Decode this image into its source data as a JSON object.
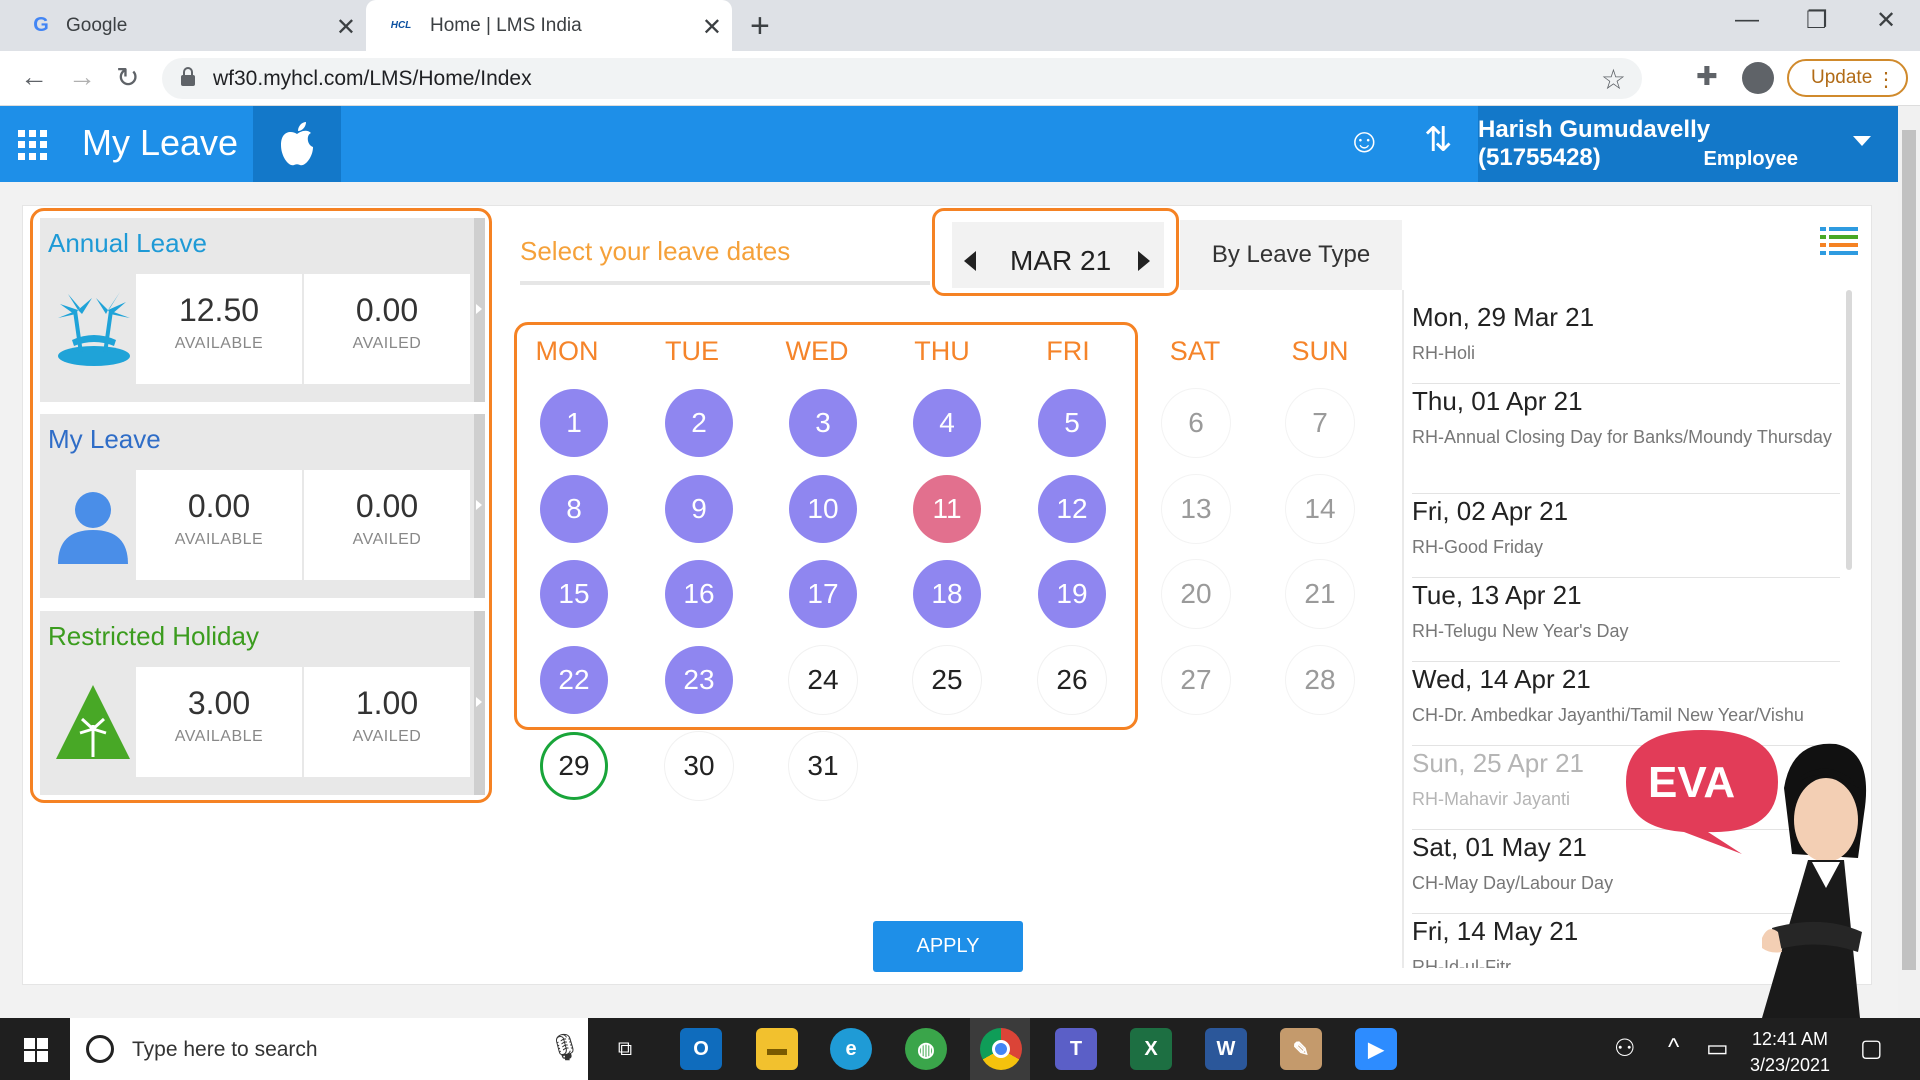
{
  "browser": {
    "tabs": [
      {
        "title": "Google",
        "favicon": "G"
      },
      {
        "title": "Home | LMS India",
        "favicon": "HCL"
      }
    ],
    "url": "wf30.myhcl.com/LMS/Home/Index",
    "update_label": "Update"
  },
  "header": {
    "title": "My Leave",
    "user_name": "Harish Gumudavelly (51755428)",
    "user_role": "Employee"
  },
  "cards": [
    {
      "title": "Annual Leave",
      "available": "12.50",
      "availed": "0.00",
      "available_label": "AVAILABLE",
      "availed_label": "AVAILED",
      "color": "#1e9ad6"
    },
    {
      "title": "My Leave",
      "available": "0.00",
      "availed": "0.00",
      "available_label": "AVAILABLE",
      "availed_label": "AVAILED",
      "color": "#2f6dc7"
    },
    {
      "title": "Restricted Holiday",
      "available": "3.00",
      "availed": "1.00",
      "available_label": "AVAILABLE",
      "availed_label": "AVAILED",
      "color": "#3b9c1e"
    }
  ],
  "calendar": {
    "prompt": "Select your leave dates",
    "month": "MAR 21",
    "view_label": "By Leave Type",
    "weekdays": [
      "MON",
      "TUE",
      "WED",
      "THU",
      "FRI",
      "SAT",
      "SUN"
    ],
    "weeks": [
      [
        "1",
        "2",
        "3",
        "4",
        "5",
        "6",
        "7"
      ],
      [
        "8",
        "9",
        "10",
        "11",
        "12",
        "13",
        "14"
      ],
      [
        "15",
        "16",
        "17",
        "18",
        "19",
        "20",
        "21"
      ],
      [
        "22",
        "23",
        "24",
        "25",
        "26",
        "27",
        "28"
      ],
      [
        "29",
        "30",
        "31"
      ]
    ],
    "apply_label": "APPLY"
  },
  "holidays": [
    {
      "date": "Mon, 29 Mar 21",
      "name": "RH-Holi"
    },
    {
      "date": "Thu, 01 Apr 21",
      "name": "RH-Annual Closing Day for Banks/Moundy Thursday"
    },
    {
      "date": "Fri, 02 Apr 21",
      "name": "RH-Good Friday"
    },
    {
      "date": "Tue, 13 Apr 21",
      "name": "RH-Telugu New Year's Day"
    },
    {
      "date": "Wed, 14 Apr 21",
      "name": "CH-Dr. Ambedkar Jayanthi/Tamil New Year/Vishu"
    },
    {
      "date": "Sun, 25 Apr 21",
      "name": "RH-Mahavir Jayanti"
    },
    {
      "date": "Sat, 01 May 21",
      "name": "CH-May Day/Labour Day"
    },
    {
      "date": "Fri, 14 May 21",
      "name": "RH-Id-ul-Fitr"
    }
  ],
  "assistant": {
    "label": "EVA"
  },
  "taskbar": {
    "search_placeholder": "Type here to search",
    "time": "12:41 AM",
    "date": "3/23/2021"
  }
}
